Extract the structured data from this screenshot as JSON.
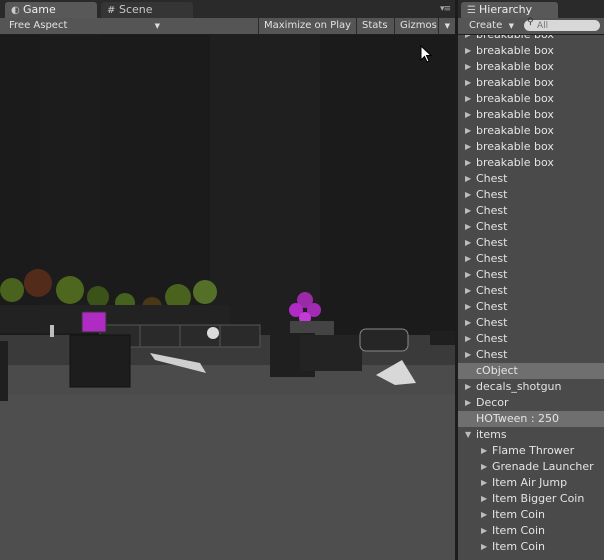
{
  "game": {
    "tab_label": "Game",
    "aspect_label": "Free Aspect",
    "maximize_label": "Maximize on Play",
    "stats_label": "Stats",
    "gizmos_label": "Gizmos"
  },
  "scene": {
    "tab_label": "Scene"
  },
  "hierarchy": {
    "tab_label": "Hierarchy",
    "create_label": "Create",
    "search_placeholder": "All",
    "items": [
      {
        "label": "breakable box",
        "expandable": true
      },
      {
        "label": "breakable box",
        "expandable": true
      },
      {
        "label": "breakable box",
        "expandable": true
      },
      {
        "label": "breakable box",
        "expandable": true
      },
      {
        "label": "breakable box",
        "expandable": true
      },
      {
        "label": "breakable box",
        "expandable": true
      },
      {
        "label": "breakable box",
        "expandable": true
      },
      {
        "label": "breakable box",
        "expandable": true
      },
      {
        "label": "breakable box",
        "expandable": true
      },
      {
        "label": "Chest",
        "expandable": true
      },
      {
        "label": "Chest",
        "expandable": true
      },
      {
        "label": "Chest",
        "expandable": true
      },
      {
        "label": "Chest",
        "expandable": true
      },
      {
        "label": "Chest",
        "expandable": true
      },
      {
        "label": "Chest",
        "expandable": true
      },
      {
        "label": "Chest",
        "expandable": true
      },
      {
        "label": "Chest",
        "expandable": true
      },
      {
        "label": "Chest",
        "expandable": true
      },
      {
        "label": "Chest",
        "expandable": true
      },
      {
        "label": "Chest",
        "expandable": true
      },
      {
        "label": "Chest",
        "expandable": true
      },
      {
        "label": "cObject",
        "expandable": false,
        "selected": true
      },
      {
        "label": "decals_shotgun",
        "expandable": true
      },
      {
        "label": "Decor",
        "expandable": true
      },
      {
        "label": "HOTween : 250",
        "expandable": false,
        "selected": true
      },
      {
        "label": "items",
        "expandable": true,
        "expanded": true
      },
      {
        "label": "Flame Thrower",
        "expandable": true,
        "child": true
      },
      {
        "label": "Grenade Launcher",
        "expandable": true,
        "child": true
      },
      {
        "label": "Item Air Jump",
        "expandable": true,
        "child": true
      },
      {
        "label": "Item Bigger Coin",
        "expandable": true,
        "child": true
      },
      {
        "label": "Item Coin",
        "expandable": true,
        "child": true
      },
      {
        "label": "Item Coin",
        "expandable": true,
        "child": true
      },
      {
        "label": "Item Coin",
        "expandable": true,
        "child": true
      }
    ]
  },
  "colors": {
    "selection_row": "#6f6f6f",
    "magenta_object": "#b02bc4",
    "foliage_green": "#5b7a2a"
  }
}
